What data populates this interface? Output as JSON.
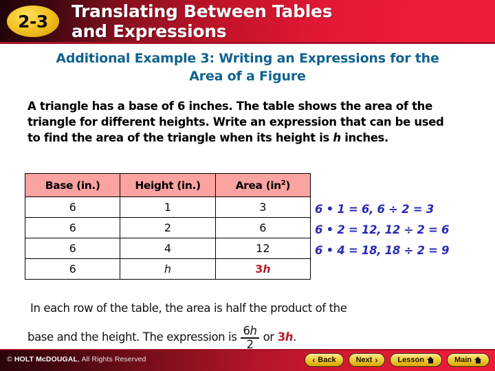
{
  "header": {
    "badge": "2-3",
    "title_line1": "Translating Between Tables",
    "title_line2": "and Expressions",
    "bg_color_left": "#1d0407",
    "bg_color_right": "#ef1c3a"
  },
  "subtitle": {
    "line1": "Additional Example 3: Writing an Expressions for the",
    "line2": "Area of a Figure",
    "color": "#10628e"
  },
  "problem": {
    "part1": "A triangle has a base of 6 inches. The table shows the area of the triangle for different heights. Write an expression that can be used to find the area of the triangle when its height is ",
    "variable": "h",
    "part2": " inches."
  },
  "table": {
    "headers": [
      "Base (in.)",
      "Height (in.)",
      "Area (in",
      "2",
      ")"
    ],
    "header_base": "Base (in.)",
    "header_height": "Height (in.)",
    "header_area_text": "Area (in",
    "header_area_sup": "2",
    "header_area_close": ")",
    "header_bg": "#fba3a0",
    "rows": [
      {
        "base": "6",
        "height": "1",
        "area": "3",
        "area_is_expression": false
      },
      {
        "base": "6",
        "height": "2",
        "area": "6",
        "area_is_expression": false
      },
      {
        "base": "6",
        "height": "4",
        "area": "12",
        "area_is_expression": false
      },
      {
        "base": "6",
        "height": "h",
        "area_coefficient": "3",
        "area_variable": "h",
        "area_is_expression": true
      }
    ]
  },
  "equations": {
    "color": "#2a2ab5",
    "items": [
      "6 • 1 = 6, 6 ÷ 2 = 3",
      "6 • 2 = 12, 12 ÷ 2 = 6",
      "6 • 4 = 18, 18 ÷ 2 = 9"
    ]
  },
  "conclusion": {
    "line1": "In each row of the table, the area is half the product of the",
    "line2_before": "base and the height. The expression is",
    "fraction_numerator_coef": "6",
    "fraction_numerator_var": "h",
    "fraction_denominator": "2",
    "line2_or": "or",
    "answer_coef": "3",
    "answer_var": "h",
    "line2_period": ".",
    "answer_color": "#b81e28"
  },
  "footer": {
    "copyright_symbol": "©",
    "copyright_brand": "HOLT McDOUGAL",
    "copyright_rest": ", All Rights Reserved",
    "buttons": [
      {
        "label": "Back",
        "icon": "chevron-left",
        "glyph": "‹"
      },
      {
        "label": "Next",
        "icon": "chevron-right",
        "glyph": "›"
      },
      {
        "label": "Lesson",
        "icon": "home"
      },
      {
        "label": "Main",
        "icon": "home"
      }
    ]
  }
}
